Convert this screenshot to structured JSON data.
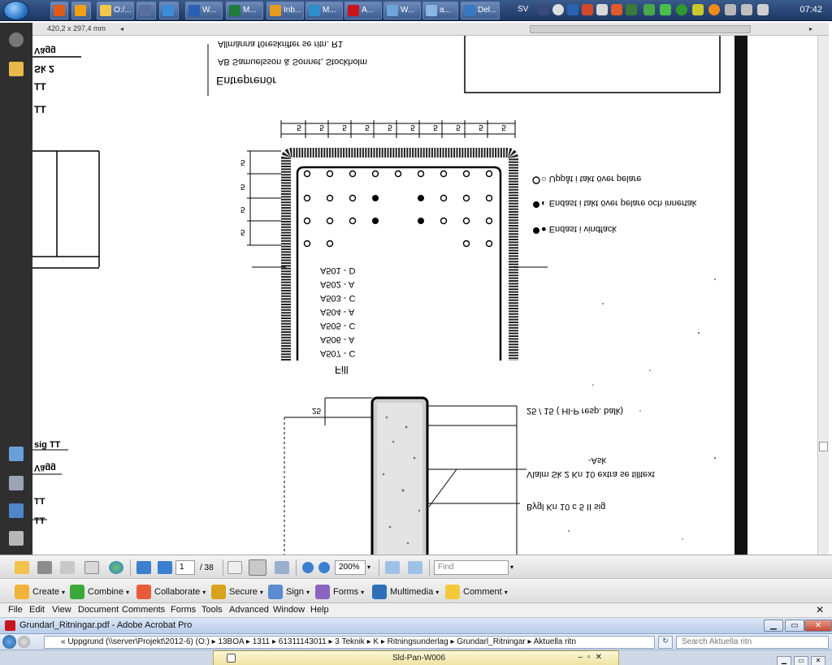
{
  "taskbar": {
    "buttons": [
      "O:/...",
      "W...",
      "M...",
      "M...",
      "Inb...",
      "M...",
      "A...",
      "W...",
      "a...",
      "Del..."
    ],
    "lang": "SV",
    "clock": "07:42"
  },
  "ruler": {
    "page_size": "420,2 x 297,4 mm"
  },
  "document": {
    "contractor_heading": "Entreprenör",
    "contractor_company": "AB Samuelsson & Sonnet, Stockholm",
    "contractor_detail": "Allmänna föreskrifter se ritn. R1",
    "left_labels": [
      "Vägg",
      "Sk 2",
      "TT",
      "TT"
    ],
    "legend": [
      "○ Uppåt i takt över pelare",
      "◐ Endast i takt över pelare och innertak",
      "● Endast i vindfack"
    ],
    "fill_label": "Fill",
    "numbers_top": [
      "5",
      "5",
      "5",
      "5",
      "5",
      "5",
      "5",
      "5",
      "5",
      "5"
    ],
    "numbers_side": [
      "5",
      "5",
      "5",
      "5"
    ],
    "section_labels": [
      "A501 - D",
      "A502 - A",
      "A503 - C",
      "A504 - A",
      "A505 - C",
      "A506 - A",
      "A507 - C"
    ],
    "callout_1": "25 / 15 ( Hl-P resp. balk)",
    "callout_2": "Vlalm Sk 2 Kn 10 extra se tilltext",
    "callout_2b": "-Ask",
    "callout_3": "Bygl Kn 10 c 5 II sig",
    "left_bottom_labels": [
      "sig TT",
      "Vägg",
      "TT",
      "TT"
    ],
    "dim_label": "25"
  },
  "toolbar1": {
    "page_current": "1",
    "page_total": "/ 38",
    "zoom": "200%",
    "find_placeholder": "Find"
  },
  "toolbar2": {
    "create": "Create",
    "combine": "Combine",
    "collaborate": "Collaborate",
    "secure": "Secure",
    "sign": "Sign",
    "forms": "Forms",
    "multimedia": "Multimedia",
    "comment": "Comment"
  },
  "menubar": [
    "File",
    "Edit",
    "View",
    "Document",
    "Comments",
    "Forms",
    "Tools",
    "Advanced",
    "Window",
    "Help"
  ],
  "titlebar": {
    "title": "Grundarl_Ritningar.pdf - Adobe Acrobat Pro"
  },
  "addressbar": {
    "path": "«  Uppgrund (\\\\server\\Projekt\\2012-6) (O:)  ▸  13BOA  ▸  1311  ▸  61311143011  ▸  3 Teknik  ▸  K  ▸  Ritningsunderlag  ▸  Grundarl_Ritningar  ▸  Aktuella ritn",
    "search_placeholder": "Search Aktuella ritn"
  },
  "bottom_window": {
    "label": "Sld-Pan-W006"
  },
  "colors": {
    "taskbar": "#1c3763",
    "nav_panel": "#2f2f2f",
    "acrobat_red": "#c8161d"
  }
}
